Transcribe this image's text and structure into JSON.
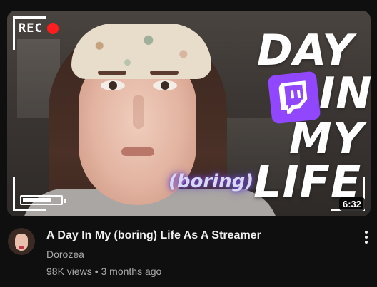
{
  "thumbnail": {
    "rec_label": "REC",
    "art_words": {
      "day": "DAY",
      "in": "IN",
      "my": "MY",
      "boring": "(boring)",
      "life": "LIFE"
    },
    "duration": "6:32",
    "twitch_icon": "twitch-logo-icon",
    "colors": {
      "rec_dot": "#ff1d1d",
      "twitch": "#9147ff"
    },
    "battery_level": 0.75
  },
  "video": {
    "title": "A Day In My (boring) Life As A Streamer",
    "channel": "Dorozea",
    "views": "98K views",
    "separator": "•",
    "age": "3 months ago"
  },
  "menu_icon": "more-vertical-icon"
}
